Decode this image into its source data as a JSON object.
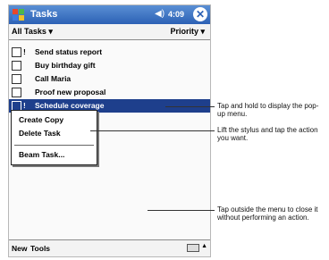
{
  "titlebar": {
    "app_title": "Tasks",
    "speaker_icon": "speaker-icon",
    "clock": "4:09",
    "ok_label": "ok"
  },
  "filterbar": {
    "category": "All Tasks ▾",
    "sort": "Priority ▾"
  },
  "tasks": [
    {
      "priority": "!",
      "label": "Send status report"
    },
    {
      "priority": "",
      "label": "Buy birthday gift"
    },
    {
      "priority": "",
      "label": "Call Maria"
    },
    {
      "priority": "",
      "label": "Proof new proposal"
    },
    {
      "priority": "!",
      "label": "Schedule coverage"
    }
  ],
  "popup_menu": {
    "items": [
      "Create Copy",
      "Delete Task",
      "Beam Task..."
    ]
  },
  "menubar": {
    "new_label": "New",
    "tools_label": "Tools",
    "input_icon": "keyboard-icon"
  },
  "callouts": [
    "Tap and hold to display the pop-up menu.",
    "Lift the stylus and tap the action you want.",
    "Tap outside the menu to close it without performing an action."
  ]
}
